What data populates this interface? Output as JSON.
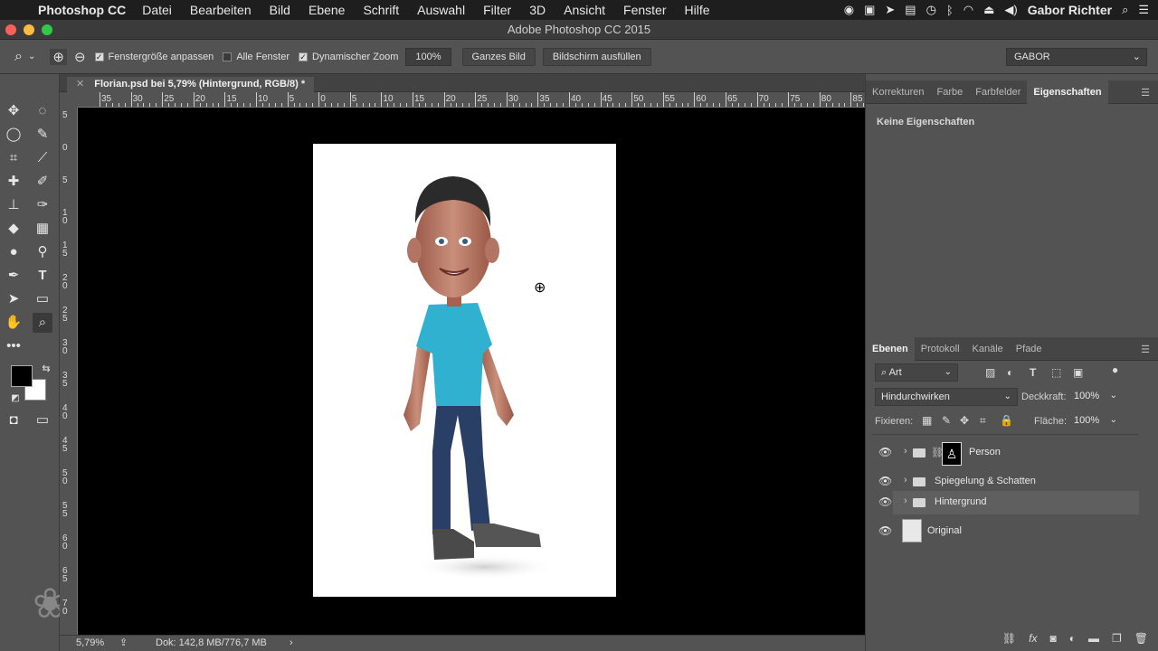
{
  "menubar": {
    "app": "Photoshop CC",
    "items": [
      "Datei",
      "Bearbeiten",
      "Bild",
      "Ebene",
      "Schrift",
      "Auswahl",
      "Filter",
      "3D",
      "Ansicht",
      "Fenster",
      "Hilfe"
    ],
    "user": "Gabor Richter"
  },
  "window": {
    "title": "Adobe Photoshop CC 2015"
  },
  "options": {
    "fit_window": "Fenstergröße anpassen",
    "all_windows": "Alle Fenster",
    "dynamic_zoom": "Dynamischer Zoom",
    "zoom_value": "100%",
    "whole_image": "Ganzes Bild",
    "fill_screen": "Bildschirm ausfüllen",
    "workspace": "GABOR"
  },
  "document": {
    "tab_title": "Florian.psd bei 5,79% (Hintergrund, RGB/8) *",
    "zoom": "5,79%",
    "doc_size": "Dok: 142,8 MB/776,7 MB",
    "hruler_labels": [
      "35",
      "30",
      "25",
      "20",
      "15",
      "10",
      "5",
      "0",
      "5",
      "10",
      "15",
      "20",
      "25",
      "30",
      "35",
      "40",
      "45",
      "50",
      "55",
      "60",
      "65",
      "70",
      "75",
      "80",
      "85"
    ],
    "vruler_labels": [
      "5",
      "0",
      "5",
      "1 0",
      "1 5",
      "2 0",
      "2 5",
      "3 0",
      "3 5",
      "4 0",
      "4 5",
      "5 0",
      "5 5",
      "6 0",
      "6 5",
      "7 0"
    ]
  },
  "properties_panel": {
    "tabs": [
      "Korrekturen",
      "Farbe",
      "Farbfelder",
      "Eigenschaften"
    ],
    "active_tab": "Eigenschaften",
    "empty_text": "Keine Eigenschaften"
  },
  "layers_panel": {
    "tabs": [
      "Ebenen",
      "Protokoll",
      "Kanäle",
      "Pfade"
    ],
    "active_tab": "Ebenen",
    "filter_kind": "Art",
    "blend_mode": "Hindurchwirken",
    "opacity_label": "Deckkraft:",
    "opacity": "100%",
    "lock_label": "Fixieren:",
    "fill_label": "Fläche:",
    "fill": "100%",
    "layers": [
      {
        "name": "Person",
        "type": "group-with-mask"
      },
      {
        "name": "Spiegelung & Schatten",
        "type": "group"
      },
      {
        "name": "Hintergrund",
        "type": "group",
        "selected": true
      },
      {
        "name": "Original",
        "type": "smart-object"
      }
    ]
  },
  "colors": {
    "foreground": "#000000",
    "background": "#ffffff",
    "shirt": "#2fb1cf",
    "jeans": "#2a3f66"
  }
}
